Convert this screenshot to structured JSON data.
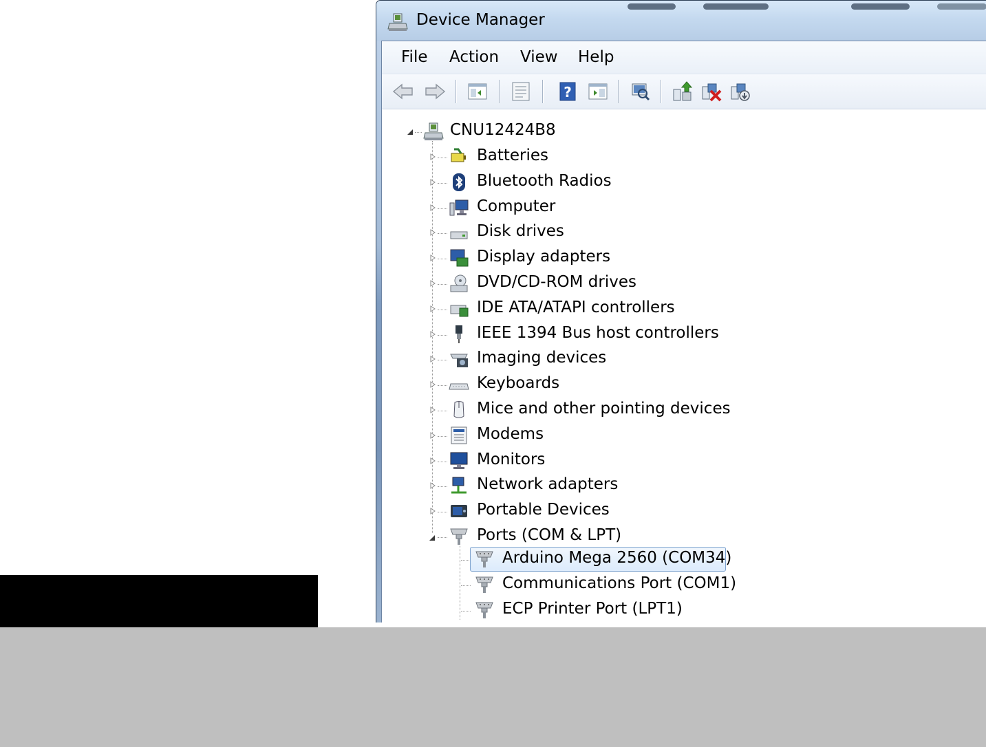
{
  "window": {
    "title": "Device Manager",
    "menu": [
      "File",
      "Action",
      "View",
      "Help"
    ],
    "toolbar_icons": [
      "back-arrow-icon",
      "forward-arrow-icon",
      "show-hide-console-tree-icon",
      "properties-icon",
      "help-icon",
      "show-action-pane-icon",
      "scan-hardware-changes-icon",
      "update-driver-icon",
      "uninstall-device-icon",
      "disable-device-icon"
    ]
  },
  "tree": {
    "root": "CNU12424B8",
    "categories": [
      {
        "label": "Batteries",
        "icon": "battery-icon"
      },
      {
        "label": "Bluetooth Radios",
        "icon": "bluetooth-icon"
      },
      {
        "label": "Computer",
        "icon": "computer-icon"
      },
      {
        "label": "Disk drives",
        "icon": "disk-drive-icon"
      },
      {
        "label": "Display adapters",
        "icon": "display-adapter-icon"
      },
      {
        "label": "DVD/CD-ROM drives",
        "icon": "dvd-drive-icon"
      },
      {
        "label": "IDE ATA/ATAPI controllers",
        "icon": "ide-controller-icon"
      },
      {
        "label": "IEEE 1394 Bus host controllers",
        "icon": "firewire-icon"
      },
      {
        "label": "Imaging devices",
        "icon": "camera-icon"
      },
      {
        "label": "Keyboards",
        "icon": "keyboard-icon"
      },
      {
        "label": "Mice and other pointing devices",
        "icon": "mouse-icon"
      },
      {
        "label": "Modems",
        "icon": "modem-icon"
      },
      {
        "label": "Monitors",
        "icon": "monitor-icon"
      },
      {
        "label": "Network adapters",
        "icon": "network-adapter-icon"
      },
      {
        "label": "Portable Devices",
        "icon": "portable-device-icon"
      },
      {
        "label": "Ports (COM & LPT)",
        "icon": "port-icon",
        "expanded": true
      }
    ],
    "ports": [
      {
        "label": "Arduino Mega 2560 (COM34)",
        "selected": true
      },
      {
        "label": "Communications Port (COM1)"
      },
      {
        "label": "ECP Printer Port (LPT1)"
      }
    ]
  }
}
